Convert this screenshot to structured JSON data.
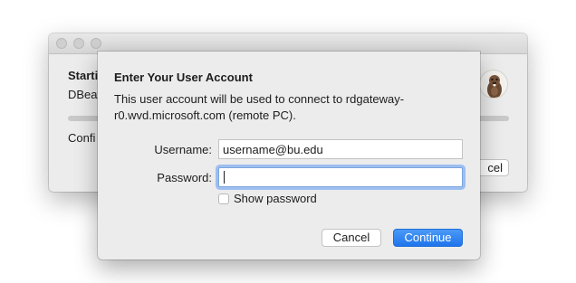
{
  "background_window": {
    "title": "Starti",
    "subtitle": "DBeat",
    "config_text": "Confi",
    "cancel_label": "cel",
    "app_icon": "dbeaver-beaver-icon",
    "progress": 0
  },
  "dialog": {
    "title": "Enter Your User Account",
    "message": "This user account will be used to connect to rdgateway-r0.wvd.microsoft.com (remote PC).",
    "username_label": "Username:",
    "username_value": "username@bu.edu",
    "password_label": "Password:",
    "password_value": "",
    "show_password_label": "Show password",
    "show_password_checked": false,
    "cancel_label": "Cancel",
    "continue_label": "Continue"
  },
  "colors": {
    "accent": "#1f74ec",
    "focus_ring": "#9dbef0",
    "window_bg": "#ececec"
  }
}
